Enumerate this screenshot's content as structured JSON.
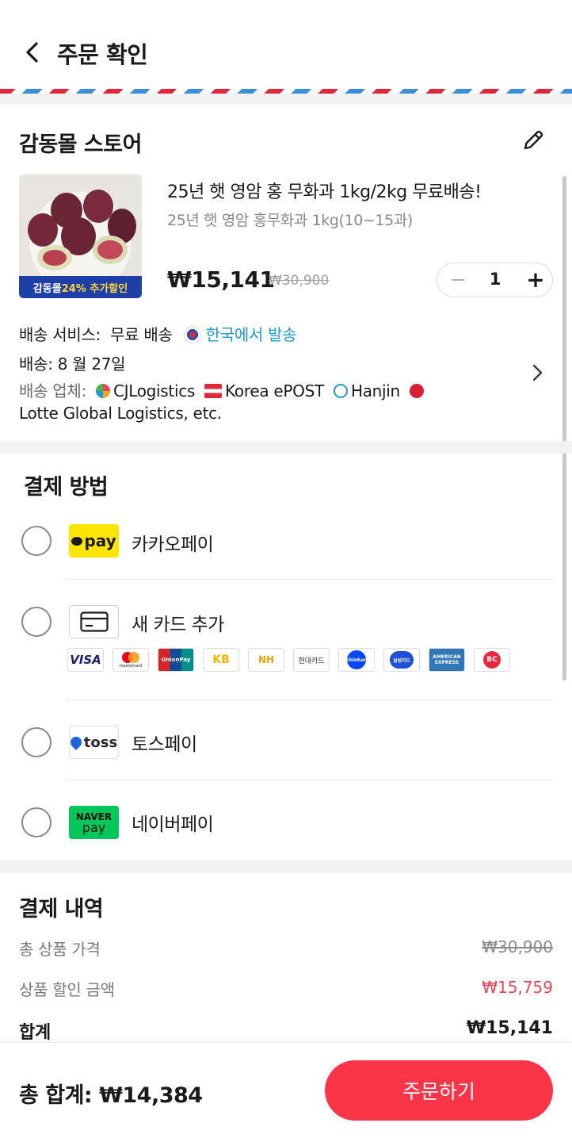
{
  "header": {
    "title": "주문 확인"
  },
  "store": {
    "name": "감동몰 스토어",
    "thumb_banner_prefix": "감동몰 ",
    "thumb_banner_highlight": "24% 추가할인"
  },
  "product": {
    "name": "25년 햇 영암 홍 무화과 1kg/2kg 무료배송!",
    "option": "25년 햇 영암 홍무화과 1kg(10~15과)",
    "price": "₩15,141",
    "original_price": "₩30,900",
    "quantity": "1",
    "qty_minus": "−",
    "qty_plus": "+"
  },
  "shipping": {
    "service_label": "배송 서비스:",
    "service_value": "무료 배송",
    "origin": "한국에서 발송",
    "date": "배송: 8 월 27일",
    "carrier_label": "배송 업체:",
    "carriers": [
      "CJLogistics",
      "Korea ePOST",
      "Hanjin",
      "Lotte Global Logistics, etc."
    ]
  },
  "payment": {
    "title": "결제 방법",
    "methods": [
      {
        "label": "카카오페이",
        "logo_text": "pay"
      },
      {
        "label": "새 카드 추가"
      },
      {
        "label": "토스페이",
        "logo_text": "toss"
      },
      {
        "label": "네이버페이",
        "logo_top": "NAVER",
        "logo_bottom": "pay"
      }
    ],
    "card_brands": [
      "VISA",
      "mastercard",
      "UnionPay",
      "KB",
      "NH",
      "현대카드",
      "Shinhan",
      "삼성카드",
      "AMERICAN EXPRESS",
      "BC"
    ]
  },
  "summary": {
    "title": "결제 내역",
    "rows": [
      {
        "label": "총 상품 가격",
        "value": "₩30,900"
      },
      {
        "label": "상품 할인 금액",
        "value": "₩15,759"
      },
      {
        "label": "합계",
        "value": "₩15,141"
      }
    ]
  },
  "footer": {
    "total_label": "총 합계: ₩14,384",
    "order_button": "주문하기"
  },
  "colors": {
    "accent": "#fb3448",
    "link_blue": "#1e9ad6",
    "discount_red": "#e8475a"
  }
}
